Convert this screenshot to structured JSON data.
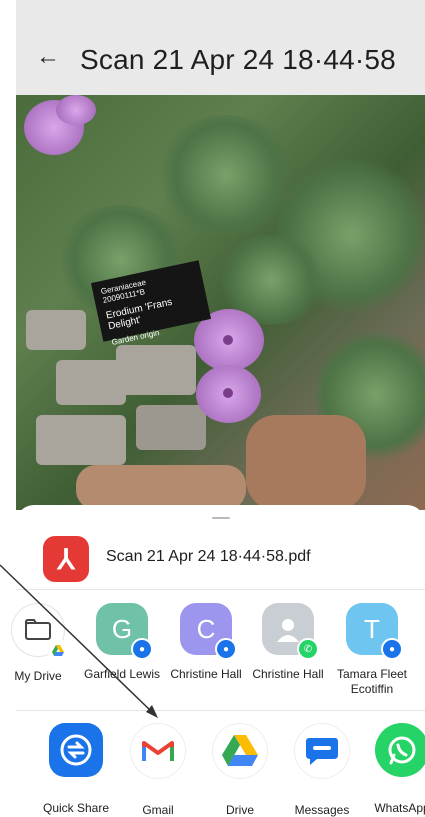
{
  "header": {
    "back_icon": "←",
    "title": "Scan 21 Apr 24 18·44·58"
  },
  "photo": {
    "tag_family": "Geraniaceae",
    "tag_number": "20090111*B",
    "tag_name": "Erodium 'Frans Delight'",
    "tag_origin": "Garden origin"
  },
  "share_sheet": {
    "file_name": "Scan 21 Apr 24 18·44·58.pdf",
    "contacts": [
      {
        "label": "My Drive",
        "initial": ""
      },
      {
        "label": "Garfield Lewis",
        "initial": "G"
      },
      {
        "label": "Christine Hall",
        "initial": "C"
      },
      {
        "label": "Christine Hall",
        "initial": ""
      },
      {
        "label": "Tamara Fleet Ecotiffin",
        "initial": "T"
      }
    ],
    "apps": [
      {
        "label": "Quick Share"
      },
      {
        "label": "Gmail"
      },
      {
        "label": "Drive"
      },
      {
        "label": "Messages"
      },
      {
        "label": "WhatsApp"
      }
    ]
  },
  "colors": {
    "accent_blue": "#1a73e8",
    "pdf_red": "#e53935",
    "whatsapp_green": "#25d366"
  }
}
